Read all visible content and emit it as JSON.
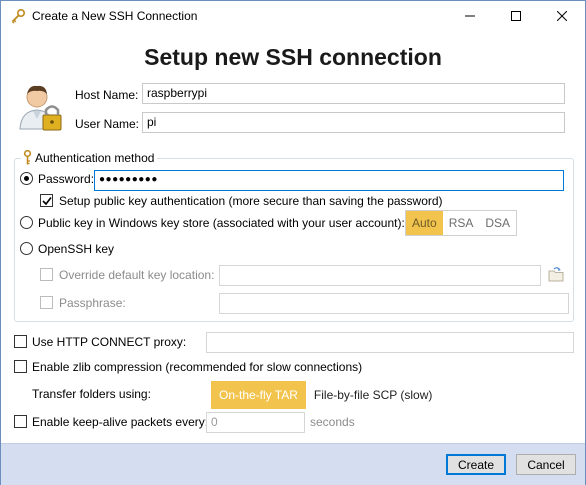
{
  "window": {
    "title": "Create a New SSH Connection",
    "icons": {
      "app": "ssh-key-icon",
      "minimize": "minimize-icon",
      "maximize": "maximize-icon",
      "close": "close-icon"
    }
  },
  "heading": "Setup new SSH connection",
  "host": {
    "label": "Host Name:",
    "value": "raspberrypi"
  },
  "user": {
    "label": "User Name:",
    "value": "pi"
  },
  "auth": {
    "legend": "Authentication method",
    "password_label": "Password:",
    "password_value": "●●●●●●●●●",
    "setup_pubkey_label": "Setup public key authentication (more secure than saving the password)",
    "winkey_label": "Public key in Windows key store (associated with your user account):",
    "key_types": [
      "Auto",
      "RSA",
      "DSA"
    ],
    "openssh_label": "OpenSSH key",
    "override_label": "Override default key location:",
    "passphrase_label": "Passphrase:"
  },
  "proxy": {
    "label": "Use HTTP CONNECT proxy:",
    "value": ""
  },
  "zlib": {
    "label": "Enable zlib compression (recommended for slow connections)"
  },
  "transfer": {
    "label": "Transfer folders using:",
    "options": [
      "On-the-fly TAR",
      "File-by-file SCP (slow)"
    ]
  },
  "keepalive": {
    "label": "Enable keep-alive packets every:",
    "placeholder": "0",
    "unit": "seconds"
  },
  "buttons": {
    "create": "Create",
    "cancel": "Cancel"
  },
  "colors": {
    "accent": "#f2c44e",
    "footer": "#d4def0",
    "focus": "#0078d7"
  }
}
